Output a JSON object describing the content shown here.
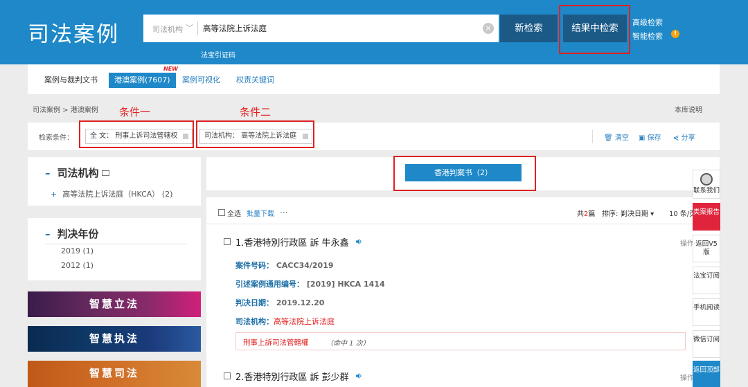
{
  "header": {
    "logo": "司法案例",
    "search_field_label": "司法机构",
    "search_value": "高等法院上诉法庭",
    "new_search": "新检索",
    "search_in_results": "结果中检索",
    "advanced_search": "高级检索",
    "smart_search": "智能检索",
    "citation_code": "法宝引证码"
  },
  "tabs": [
    {
      "label": "案例与裁判文书"
    },
    {
      "label": "港澳案例(7607)",
      "badge": "NEW"
    },
    {
      "label": "案例可视化"
    },
    {
      "label": "权责关键词"
    }
  ],
  "breadcrumb": "司法案例 > 港澳案例",
  "library_info": "本库说明",
  "annotations": {
    "condition1": "条件一",
    "condition2": "条件二"
  },
  "filter_bar": {
    "label": "检索条件：",
    "chips": [
      "全 文：  刑事上诉司法管辖权",
      "司法机构：  高等法院上诉法庭"
    ],
    "clear": "清空",
    "save": "保存",
    "share": "分享"
  },
  "sidebar": {
    "institution": {
      "title": "司法机构",
      "items": [
        "高等法院上诉法庭（HKCA）  (2)"
      ]
    },
    "year": {
      "title": "判决年份",
      "items": [
        "2019 (1)",
        "2012 (1)"
      ]
    },
    "banners": [
      "智慧立法",
      "智慧执法",
      "智慧司法"
    ]
  },
  "hk_judgment_button": "香港判案书（2）",
  "results_toolbar": {
    "select_all": "全选",
    "batch_download": "批量下载",
    "more": "...",
    "total_prefix": "共",
    "total": "2",
    "total_suffix": "篇",
    "sort_label": "排序: ↓",
    "sort_value": "判决日期 ▾",
    "per_page": "10 条/页"
  },
  "results": [
    {
      "title": "1.香港特別行政區 訴 牛永鑫",
      "ops": "操作",
      "case_no_label": "案件号码：",
      "case_no": "CACC34/2019",
      "citation_label": "引述案例通用编号：",
      "citation": "[2019] HKCA 1414",
      "date_label": "判决日期：",
      "date": "2019.12.20",
      "court_label": "司法机构：",
      "court": "高等法院上诉法庭",
      "keyword": "刑事上訴司法管轄權",
      "hits": "（命中 1 次）"
    },
    {
      "title": "2.香港特別行政區 訴 彭少群",
      "ops": "操作"
    }
  ],
  "right_sidebar": [
    "联系我们",
    "类案报告",
    "返回V5版",
    "法宝订阅",
    "手机阅读",
    "微信订阅",
    "返回顶部"
  ],
  "colors": {
    "brand_blue": "#1e88c8",
    "annotation_red": "#e02020",
    "report_red": "#e0243c"
  }
}
